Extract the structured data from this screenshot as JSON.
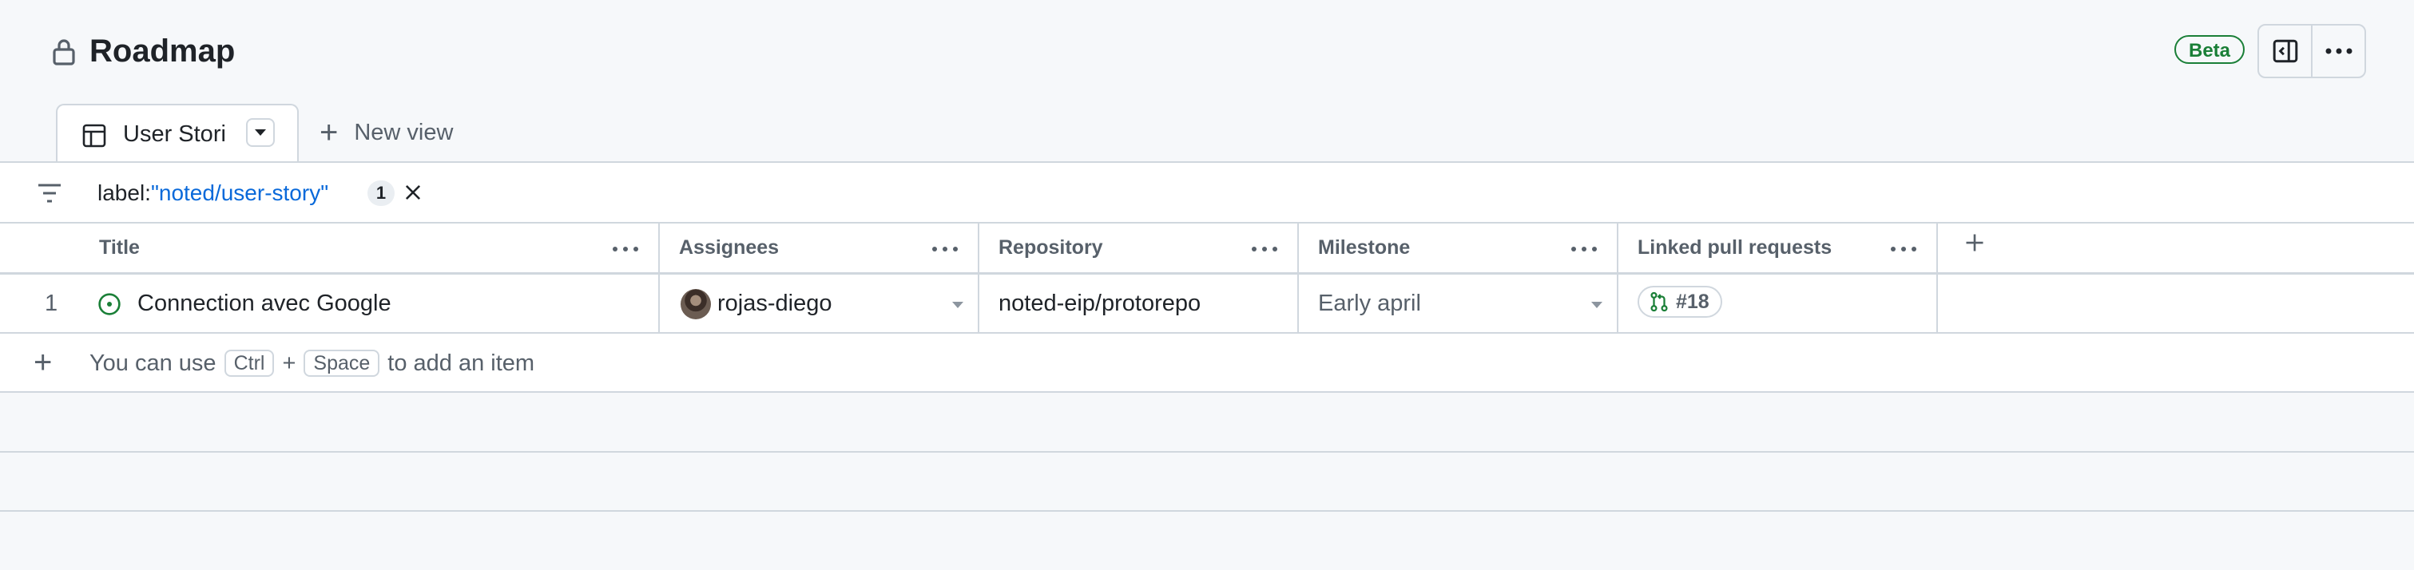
{
  "header": {
    "title": "Roadmap",
    "beta_label": "Beta"
  },
  "tabs": [
    {
      "label": "User Stori"
    }
  ],
  "new_view_label": "New view",
  "filter": {
    "key": "label:",
    "value": "\"noted/user-story\"",
    "count": "1"
  },
  "columns": {
    "title": "Title",
    "assignees": "Assignees",
    "repository": "Repository",
    "milestone": "Milestone",
    "linked_prs": "Linked pull requests"
  },
  "rows": [
    {
      "number": "1",
      "title": "Connection avec Google",
      "assignee": "rojas-diego",
      "repository": "noted-eip/protorepo",
      "milestone": "Early april",
      "linked_pr": "#18"
    }
  ],
  "add_item": {
    "prefix": "You can use",
    "key1": "Ctrl",
    "plus": "+",
    "key2": "Space",
    "suffix": "to add an item"
  },
  "colors": {
    "accent_blue": "#0969da",
    "open_green": "#1a7f37",
    "border": "#d0d7de",
    "muted_text": "#57606a"
  },
  "icons": [
    "lock-icon",
    "sidebar-panel-icon",
    "kebab-icon",
    "table-view-icon",
    "triangle-down-icon",
    "plus-icon",
    "filter-icon",
    "close-icon",
    "issue-open-icon",
    "pull-request-icon"
  ]
}
